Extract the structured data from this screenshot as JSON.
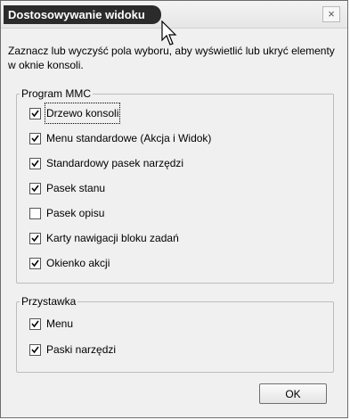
{
  "window": {
    "title": "Dostosowywanie widoku",
    "close_label": "×"
  },
  "description": "Zaznacz lub wyczyść pola wyboru, aby wyświetlić lub ukryć elementy w oknie konsoli.",
  "groups": [
    {
      "title": "Program MMC",
      "items": [
        {
          "label": "Drzewo konsoli",
          "checked": true
        },
        {
          "label": "Menu standardowe (Akcja i Widok)",
          "checked": true
        },
        {
          "label": "Standardowy pasek narzędzi",
          "checked": true
        },
        {
          "label": "Pasek stanu",
          "checked": true
        },
        {
          "label": "Pasek opisu",
          "checked": false
        },
        {
          "label": "Karty nawigacji bloku zadań",
          "checked": true
        },
        {
          "label": "Okienko akcji",
          "checked": true
        }
      ]
    },
    {
      "title": "Przystawka",
      "items": [
        {
          "label": "Menu",
          "checked": true
        },
        {
          "label": "Paski narzędzi",
          "checked": true
        }
      ]
    }
  ],
  "buttons": {
    "ok": "OK"
  }
}
